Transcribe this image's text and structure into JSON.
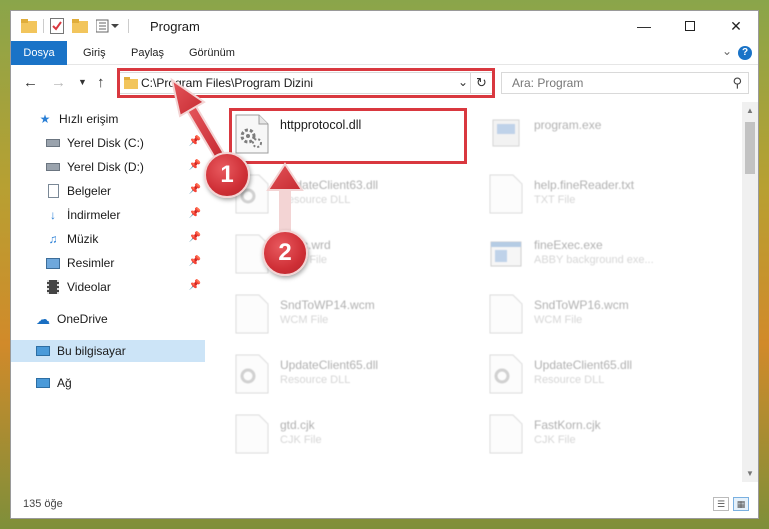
{
  "window": {
    "title": "Program"
  },
  "ribbon": {
    "tabs": [
      {
        "label": "Dosya"
      },
      {
        "label": "Giriş"
      },
      {
        "label": "Paylaş"
      },
      {
        "label": "Görünüm"
      }
    ],
    "help_label": "?"
  },
  "address": {
    "path": "C:\\Program Files\\Program Dizini"
  },
  "search": {
    "placeholder": "Ara: Program"
  },
  "sidebar": {
    "items": [
      {
        "label": "Hızlı erişim",
        "icon": "star-icon"
      },
      {
        "label": "Yerel Disk (C:)",
        "icon": "drive-icon",
        "pinned": true
      },
      {
        "label": "Yerel Disk (D:)",
        "icon": "drive-icon",
        "pinned": true
      },
      {
        "label": "Belgeler",
        "icon": "documents-icon",
        "pinned": true
      },
      {
        "label": "İndirmeler",
        "icon": "download-icon",
        "pinned": true
      },
      {
        "label": "Müzik",
        "icon": "music-icon",
        "pinned": true
      },
      {
        "label": "Resimler",
        "icon": "pictures-icon",
        "pinned": true
      },
      {
        "label": "Videolar",
        "icon": "video-icon",
        "pinned": true
      },
      {
        "label": "OneDrive",
        "icon": "cloud-icon"
      },
      {
        "label": "Bu bilgisayar",
        "icon": "computer-icon",
        "selected": true
      },
      {
        "label": "Ağ",
        "icon": "network-icon"
      }
    ]
  },
  "files": [
    {
      "name": "httpprotocol.dll",
      "type": "",
      "highlight": true
    },
    {
      "name": "program.exe",
      "type": ""
    },
    {
      "name": "UpdateClient63.dll",
      "type": "Resource DLL"
    },
    {
      "name": "help.fineReader.txt",
      "type": "TXT File"
    },
    {
      "name": "basic.wrd",
      "type": "WRD File"
    },
    {
      "name": "fineExec.exe",
      "type": "ABBY background exe..."
    },
    {
      "name": "SndToWP14.wcm",
      "type": "WCM File"
    },
    {
      "name": "SndToWP16.wcm",
      "type": "WCM File"
    },
    {
      "name": "UpdateClient65.dll",
      "type": "Resource DLL"
    },
    {
      "name": "UpdateClient65.dll",
      "type": "Resource DLL"
    },
    {
      "name": "gtd.cjk",
      "type": "CJK File"
    },
    {
      "name": "FastKorn.cjk",
      "type": "CJK File"
    }
  ],
  "status": {
    "count": "135 öğe"
  },
  "annotations": {
    "badge1": "1",
    "badge2": "2"
  },
  "colors": {
    "accent": "#1a73c7",
    "annotation_red": "#d9383f",
    "selected_bg": "#cce4f7"
  }
}
